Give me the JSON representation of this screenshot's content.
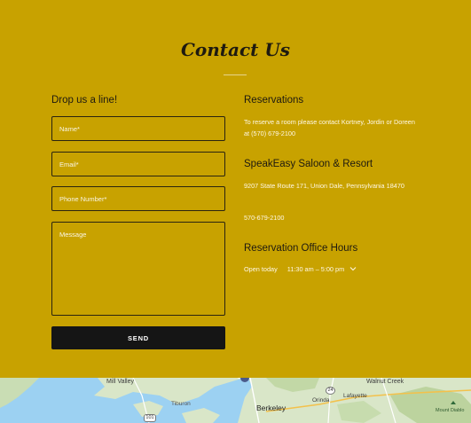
{
  "contact": {
    "title": "Contact Us",
    "form": {
      "heading": "Drop us a line!",
      "name_placeholder": "Name*",
      "email_placeholder": "Email*",
      "phone_placeholder": "Phone Number*",
      "message_placeholder": "Message",
      "send_label": "SEND"
    },
    "reservations": {
      "heading": "Reservations",
      "note": "To reserve a room please contact Kortney, Jordin or Doreen at (570) 679-2100"
    },
    "venue": {
      "name": "SpeakEasy Saloon & Resort",
      "address": "9207 State Route 171, Union Dale, Pennsylvania 18470",
      "phone": "570-679-2100"
    },
    "hours": {
      "heading": "Reservation Office Hours",
      "today_label": "Open today",
      "today_hours": "11:30 am – 5:00 pm",
      "chevron_icon": "chevron-down-icon"
    }
  },
  "map": {
    "labels": {
      "mill_valley": "Mill Valley",
      "tiburon": "Tiburon",
      "berkeley": "Berkeley",
      "orinda": "Orinda",
      "lafayette": "Lafayette",
      "walnut_creek": "Walnut Creek",
      "mount_diablo": "Mount Diablo"
    },
    "routes": {
      "r24": "24",
      "r101": "101"
    }
  },
  "colors": {
    "section_background": "#c8a200",
    "button_background": "#151515",
    "water": "#9cd1f2",
    "land": "#d9e6c8"
  }
}
